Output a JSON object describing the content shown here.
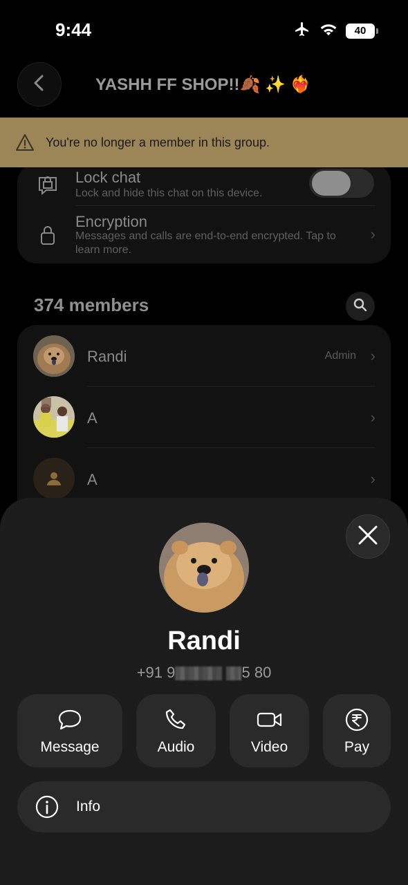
{
  "status_bar": {
    "time": "9:44",
    "battery": "40"
  },
  "header": {
    "title": "YASHH FF SHOP!!🍂 ✨ ❤️‍🔥"
  },
  "banner": {
    "text": "You're no longer a member in this group."
  },
  "settings": {
    "lock_chat": {
      "title": "Lock chat",
      "subtitle": "Lock and hide this chat on this device.",
      "enabled": false
    },
    "encryption": {
      "title": "Encryption",
      "subtitle": "Messages and calls are end-to-end encrypted. Tap to learn more."
    }
  },
  "members": {
    "heading": "374 members",
    "list": [
      {
        "name": "Randi",
        "badge": "Admin"
      },
      {
        "name": "A",
        "badge": ""
      },
      {
        "name": "A",
        "badge": ""
      }
    ]
  },
  "sheet": {
    "name": "Randi",
    "phone_prefix": "+91 9",
    "phone_suffix": "5 80",
    "actions": {
      "message": "Message",
      "audio": "Audio",
      "video": "Video",
      "pay": "Pay"
    },
    "info": "Info"
  },
  "colors": {
    "banner": "#9c8556",
    "sheet": "#1c1c1c",
    "button": "#2a2a2a"
  }
}
